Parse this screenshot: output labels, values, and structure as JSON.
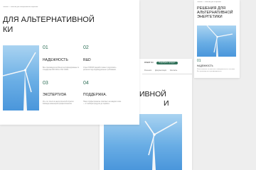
{
  "card1": {
    "breadcrumb": "Главная — Решения для альтернативной энергетики",
    "title_l1": "ДЛЯ АЛЬТЕРНАТИВНОЙ",
    "title_l2": "КИ",
    "features": [
      {
        "num": "01",
        "title": "НАДЕЖНОСТЬ",
        "desc": "Все производители Rivest сертифицированы по стандартам ISO 9001 и ISO 14001."
      },
      {
        "num": "02",
        "title": "R&D",
        "desc": "Отдел НИОКР разработ может подготовить решения под индивидуальные требования."
      },
      {
        "num": "03",
        "title": "ЭКСПЕРТИЗА",
        "desc": "20+ лет опыта в энергетической отрасли. Команда инженеров-профессионалов."
      },
      {
        "num": "04",
        "title": "ПОДДЕРЖКА.",
        "desc": "Наши профессионалы помогают на каждом этапе — от выбора продукта до сервиса."
      }
    ]
  },
  "card2": {
    "header_left": "RIVEST RU",
    "cta_label": "Подобрать продукт",
    "nav": [
      "Решения",
      "Документация",
      "Контакты"
    ],
    "title_l1": "ИВНОЙ",
    "title_l2": "И"
  },
  "card3": {
    "nav": "Главная — Решения для энергетики",
    "title": [
      "РЕШЕНИЯ ДЛЯ",
      "АЛЬТЕРНАТИВНОЙ",
      "ЭНЕРГЕТИКИ"
    ],
    "feature_num": "01",
    "feature_title": "НАДЕЖНОСТЬ",
    "feature_desc": "Rivest отвечает за качество и своевременность поставок. Все производства сертифицированы."
  },
  "colors": {
    "accent": "#2e6f57",
    "background": "#eeeeee"
  }
}
